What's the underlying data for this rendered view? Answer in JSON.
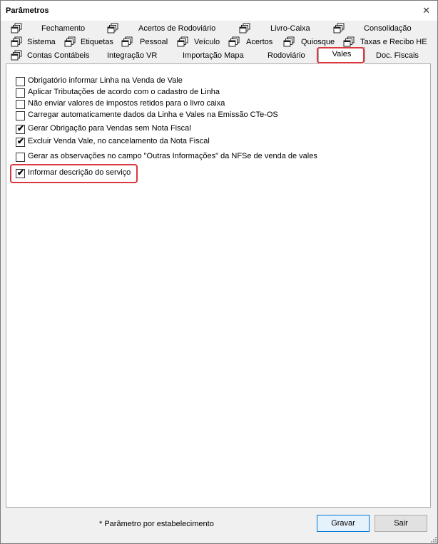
{
  "window": {
    "title": "Parâmetros",
    "close_glyph": "✕"
  },
  "tabs": {
    "row1": [
      "Fechamento",
      "Acertos de Rodoviário",
      "Livro-Caixa",
      "Consolidação"
    ],
    "row2": [
      "Sistema",
      "Etiquetas",
      "Pessoal",
      "Veículo",
      "Acertos",
      "Quiosque",
      "Taxas e Recibo HE"
    ],
    "row3": [
      "Contas Contábeis",
      "Integração VR",
      "Importação Mapa",
      "Rodoviário",
      "Vales",
      "Doc. Fiscais"
    ],
    "active": "Vales",
    "tab_icon": "stacked-windows-icon"
  },
  "options": [
    {
      "label": "Obrigatório informar Linha na Venda de Vale",
      "checked": false
    },
    {
      "label": "Aplicar Tributações de acordo com o cadastro de Linha",
      "checked": false
    },
    {
      "label": "Não enviar valores de impostos retidos para o livro caixa",
      "checked": false
    },
    {
      "label": "Carregar automaticamente dados da Linha e Vales na Emissão CTe-OS",
      "checked": false
    },
    {
      "label": "Gerar Obrigação para Vendas sem Nota Fiscal",
      "checked": true
    },
    {
      "label": "Excluir Venda Vale, no cancelamento da Nota Fiscal",
      "checked": true
    },
    {
      "label": "Gerar as observações no campo \"Outras Informações\" da NFSe de venda de vales",
      "checked": false
    },
    {
      "label": "Informar descrição do serviço",
      "checked": true
    }
  ],
  "check_glyph": "✔",
  "footer": {
    "note": "* Parâmetro por estabelecimento",
    "save_label": "Gravar",
    "exit_label": "Sair"
  },
  "colors": {
    "highlight": "#d9393f",
    "primary_button_border": "#0078d7"
  }
}
